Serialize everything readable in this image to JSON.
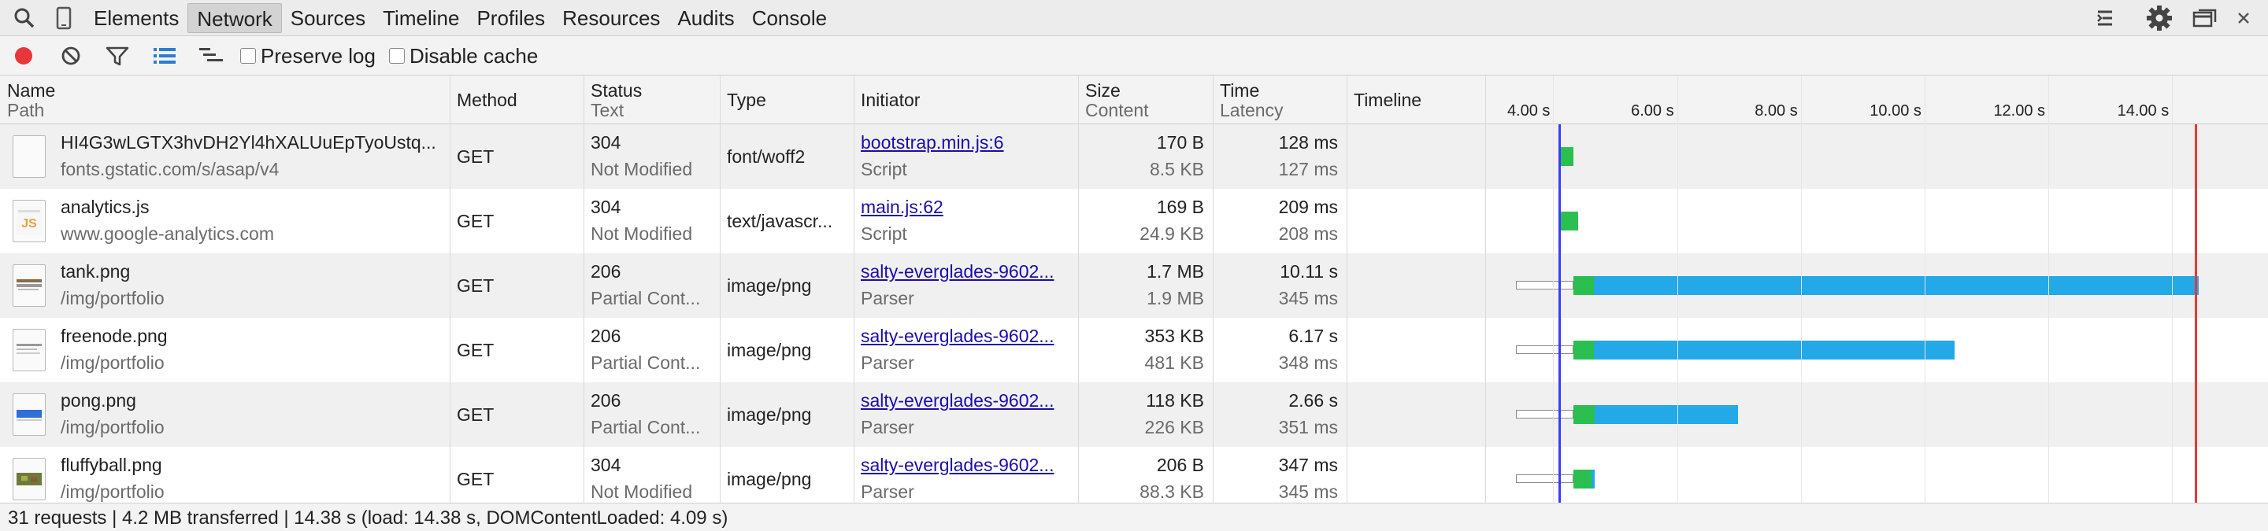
{
  "tabs": [
    "Elements",
    "Network",
    "Sources",
    "Timeline",
    "Profiles",
    "Resources",
    "Audits",
    "Console"
  ],
  "active_tab": "Network",
  "toolbar": {
    "preserve_log": "Preserve log",
    "disable_cache": "Disable cache",
    "record_color": "#e8363a"
  },
  "columns": {
    "name": "Name",
    "name_sub": "Path",
    "method": "Method",
    "status": "Status",
    "status_sub": "Text",
    "type": "Type",
    "initiator": "Initiator",
    "size": "Size",
    "size_sub": "Content",
    "time": "Time",
    "time_sub": "Latency",
    "timeline": "Timeline"
  },
  "timeline_ticks": [
    "4.00 s",
    "6.00 s",
    "8.00 s",
    "10.00 s",
    "12.00 s",
    "14.00 s"
  ],
  "timeline_scale": {
    "start_s": 2.9,
    "end_s": 15.55
  },
  "markers": {
    "domcontentloaded_s": 4.09,
    "load_s": 14.38,
    "dom_color": "#3b3bff",
    "load_color": "#e53935"
  },
  "rows": [
    {
      "name": "HI4G3wLGTX3hvDH2Yl4hXALUuEpTyoUstq...",
      "path": "fonts.gstatic.com/s/asap/v4",
      "method": "GET",
      "status": "304",
      "status_text": "Not Modified",
      "type": "font/woff2",
      "initiator": "bootstrap.min.js:6",
      "initiator_sub": "Script",
      "size": "170 B",
      "content": "8.5 KB",
      "time": "128 ms",
      "latency": "127 ms",
      "thumb": "blank",
      "start_s": 4.12,
      "wait_s": 0,
      "green_s": 0.2,
      "blue_s": 0.0
    },
    {
      "name": "analytics.js",
      "path": "www.google-analytics.com",
      "method": "GET",
      "status": "304",
      "status_text": "Not Modified",
      "type": "text/javascr...",
      "initiator": "main.js:62",
      "initiator_sub": "Script",
      "size": "169 B",
      "content": "24.9 KB",
      "time": "209 ms",
      "latency": "208 ms",
      "thumb": "js",
      "start_s": 4.12,
      "wait_s": 0,
      "green_s": 0.28,
      "blue_s": 0.0
    },
    {
      "name": "tank.png",
      "path": "/img/portfolio",
      "method": "GET",
      "status": "206",
      "status_text": "Partial Cont...",
      "type": "image/png",
      "initiator": "salty-everglades-9602...",
      "initiator_sub": "Parser",
      "size": "1.7 MB",
      "content": "1.9 MB",
      "time": "10.11 s",
      "latency": "345 ms",
      "thumb": "tank",
      "start_s": 3.4,
      "wait_s": 0.92,
      "green_s": 0.34,
      "blue_s": 9.77
    },
    {
      "name": "freenode.png",
      "path": "/img/portfolio",
      "method": "GET",
      "status": "206",
      "status_text": "Partial Cont...",
      "type": "image/png",
      "initiator": "salty-everglades-9602...",
      "initiator_sub": "Parser",
      "size": "353 KB",
      "content": "481 KB",
      "time": "6.17 s",
      "latency": "348 ms",
      "thumb": "doc",
      "start_s": 3.4,
      "wait_s": 0.92,
      "green_s": 0.34,
      "blue_s": 5.83
    },
    {
      "name": "pong.png",
      "path": "/img/portfolio",
      "method": "GET",
      "status": "206",
      "status_text": "Partial Cont...",
      "type": "image/png",
      "initiator": "salty-everglades-9602...",
      "initiator_sub": "Parser",
      "size": "118 KB",
      "content": "226 KB",
      "time": "2.66 s",
      "latency": "351 ms",
      "thumb": "pong",
      "start_s": 3.4,
      "wait_s": 0.92,
      "green_s": 0.35,
      "blue_s": 2.31
    },
    {
      "name": "fluffyball.png",
      "path": "/img/portfolio",
      "method": "GET",
      "status": "304",
      "status_text": "Not Modified",
      "type": "image/png",
      "initiator": "salty-everglades-9602...",
      "initiator_sub": "Parser",
      "size": "206 B",
      "content": "88.3 KB",
      "time": "347 ms",
      "latency": "345 ms",
      "thumb": "fluffy",
      "start_s": 3.4,
      "wait_s": 0.92,
      "green_s": 0.3,
      "blue_s": 0.05
    }
  ],
  "status_summary": "31 requests | 4.2 MB transferred | 14.38 s (load: 14.38 s, DOMContentLoaded: 4.09 s)"
}
